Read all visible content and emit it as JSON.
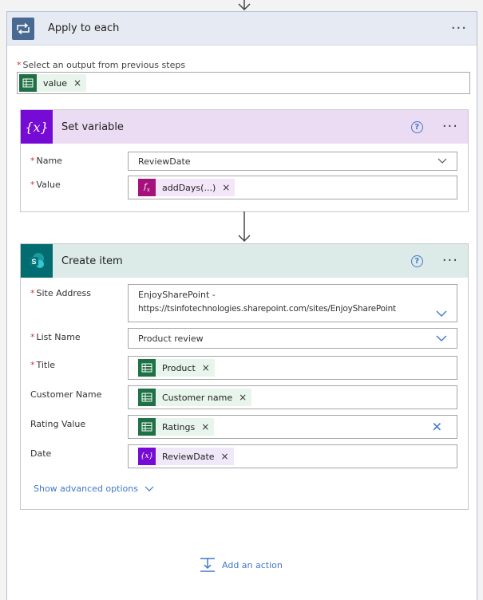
{
  "loop": {
    "title": "Apply to each",
    "select_label": "Select an output from previous steps",
    "select_token": "value"
  },
  "set_variable": {
    "title": "Set variable",
    "name_label": "Name",
    "name_value": "ReviewDate",
    "value_label": "Value",
    "value_token": "addDays(...)"
  },
  "create_item": {
    "title": "Create item",
    "site_label": "Site Address",
    "site_value_line1": "EnjoySharePoint -",
    "site_value_line2": "https://tsinfotechnologies.sharepoint.com/sites/EnjoySharePoint",
    "list_label": "List Name",
    "list_value": "Product review",
    "title_label": "Title",
    "title_token": "Product",
    "customer_label": "Customer Name",
    "customer_token": "Customer name",
    "rating_label": "Rating Value",
    "rating_token": "Ratings",
    "date_label": "Date",
    "date_token": "ReviewDate",
    "advanced_label": "Show advanced options"
  },
  "add_action_label": "Add an action",
  "colors": {
    "loop_header": "#e6eaf2",
    "variable_header": "#ebdbf3",
    "variable_icon": "#770bd6",
    "sharepoint_header": "#dcebe8",
    "sharepoint_icon": "#036c70",
    "excel": "#1e7145",
    "link": "#3f79c9"
  },
  "icons": {
    "loop": "loop-icon",
    "variable": "variable-icon",
    "sharepoint": "sharepoint-icon",
    "excel": "excel-icon",
    "expression": "fx-icon"
  }
}
